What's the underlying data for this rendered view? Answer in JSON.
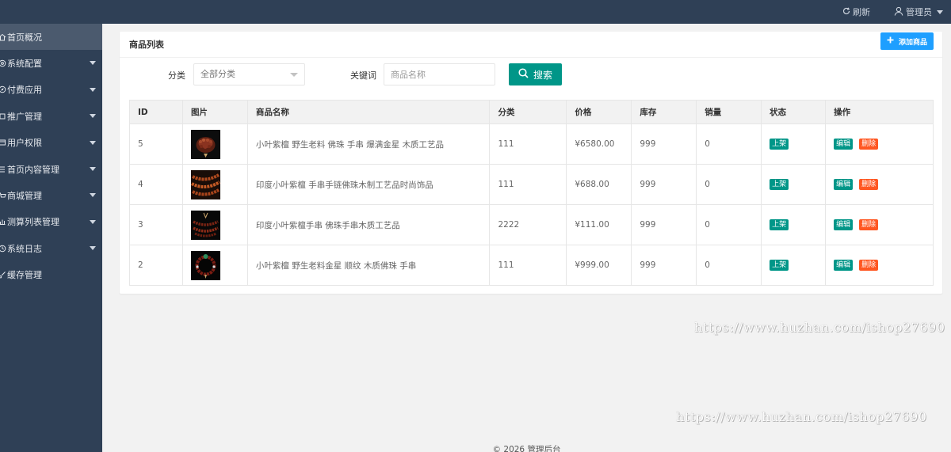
{
  "topbar": {
    "refresh_label": "刷新",
    "admin_label": "管理员"
  },
  "sidebar": {
    "items": [
      {
        "label": "首页概况",
        "active": true
      },
      {
        "label": "系统配置"
      },
      {
        "label": "付费应用"
      },
      {
        "label": "推广管理"
      },
      {
        "label": "用户权限"
      },
      {
        "label": "首页内容管理"
      },
      {
        "label": "商城管理"
      },
      {
        "label": "测算列表管理"
      },
      {
        "label": "系统日志"
      },
      {
        "label": "缓存管理"
      }
    ]
  },
  "panel": {
    "title": "商品列表",
    "add_label": "添加商品"
  },
  "search": {
    "category_label": "分类",
    "category_value": "全部分类",
    "keyword_label": "关键词",
    "keyword_placeholder": "商品名称",
    "button_label": "搜索"
  },
  "table": {
    "headers": [
      "ID",
      "图片",
      "商品名称",
      "分类",
      "价格",
      "库存",
      "销量",
      "状态",
      "操作"
    ],
    "rows": [
      {
        "id": "5",
        "name": "小叶紫檀 野生老料 佛珠 手串 爆满金星 木质工艺品",
        "category": "111",
        "price": "¥6580.00",
        "stock": "999",
        "sales": "0",
        "status": "上架",
        "edit": "编辑",
        "delete": "删除"
      },
      {
        "id": "4",
        "name": "印度小叶紫檀 手串手链佛珠木制工艺品时尚饰品",
        "category": "111",
        "price": "¥688.00",
        "stock": "999",
        "sales": "0",
        "status": "上架",
        "edit": "编辑",
        "delete": "删除"
      },
      {
        "id": "3",
        "name": "印度小叶紫檀手串 佛珠手串木质工艺品",
        "category": "2222",
        "price": "¥111.00",
        "stock": "999",
        "sales": "0",
        "status": "上架",
        "edit": "编辑",
        "delete": "删除"
      },
      {
        "id": "2",
        "name": "小叶紫檀 野生老料金星 顺纹 木质佛珠 手串",
        "category": "111",
        "price": "¥999.00",
        "stock": "999",
        "sales": "0",
        "status": "上架",
        "edit": "编辑",
        "delete": "删除"
      }
    ]
  },
  "watermark": "https://www.huzhan.com/ishop27690",
  "footer": "© 2026 管理后台",
  "colors": {
    "sidebar": "#2f4056",
    "primary_green": "#009688",
    "add_blue": "#1e9fff",
    "delete_orange": "#ff5722"
  }
}
